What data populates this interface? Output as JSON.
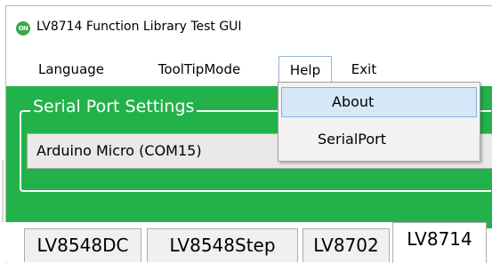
{
  "window": {
    "title": "LV8714 Function Library Test GUI",
    "icon_text": "ON",
    "accent_color": "#23b24a"
  },
  "menubar": {
    "items": [
      {
        "label": "Language"
      },
      {
        "label": "ToolTipMode"
      },
      {
        "label": "Help"
      },
      {
        "label": "Exit"
      }
    ]
  },
  "help_menu": {
    "items": [
      {
        "label": "About"
      },
      {
        "label": "SerialPort"
      }
    ]
  },
  "serial_settings": {
    "group_title": "Serial Port Settings",
    "selected_port": "Arduino Micro (COM15)"
  },
  "tabs": [
    {
      "label": "LV8548DC"
    },
    {
      "label": "LV8548Step"
    },
    {
      "label": "LV8702"
    },
    {
      "label": "LV8714",
      "active": true
    }
  ]
}
